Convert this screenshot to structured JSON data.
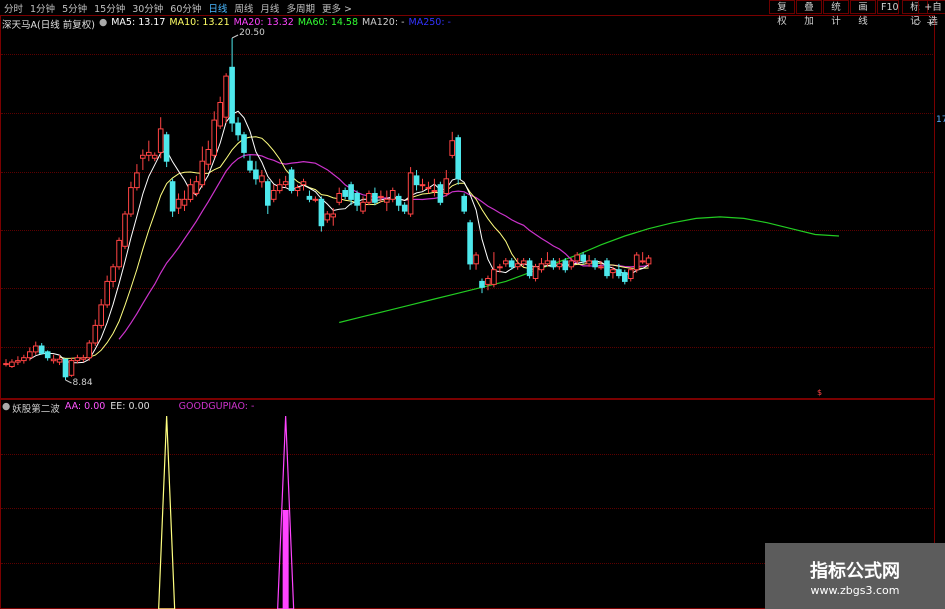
{
  "toolbar": {
    "periods": [
      "分时",
      "1分钟",
      "5分钟",
      "15分钟",
      "30分钟",
      "60分钟",
      "日线",
      "周线",
      "月线",
      "多周期",
      "更多 >"
    ],
    "active_period": "日线",
    "right_buttons": [
      "复权",
      "叠加",
      "统计",
      "画线",
      "F10",
      "标记",
      "+自选"
    ]
  },
  "main_chart": {
    "title": "深天马A",
    "adjust": "(日线 前复权)",
    "ma": [
      {
        "label": "MA5: 13.17",
        "color": "#ffffff"
      },
      {
        "label": "MA10: 13.21",
        "color": "#ffff66"
      },
      {
        "label": "MA20: 13.32",
        "color": "#ff44ff"
      },
      {
        "label": "MA60: 14.58",
        "color": "#33ff33"
      },
      {
        "label": "MA120: -",
        "color": "#cccccc"
      },
      {
        "label": "MA250: -",
        "color": "#3333ff"
      }
    ],
    "high_label": "20.50",
    "low_label": "8.84",
    "right_tag": "17",
    "colors": {
      "up": "#ff4444",
      "down": "#4ee8ec",
      "ma5": "#ffffff",
      "ma10": "#ffff80",
      "ma20": "#cc33cc",
      "ma60": "#22cc22"
    }
  },
  "indicator": {
    "name": "妖股第二波",
    "values": [
      {
        "label": "AA: 0.00",
        "color": "#ff55ff"
      },
      {
        "label": "EE: 0.00",
        "color": "#dddddd"
      },
      {
        "label": "GOODGUPIAO: -",
        "color": "#cc33cc"
      }
    ]
  },
  "watermark": {
    "title": "指标公式网",
    "url": "www.zbgs3.com"
  },
  "chart_data": {
    "type": "candlestick",
    "series_names": [
      "MA5",
      "MA10",
      "MA20",
      "MA60"
    ],
    "price_high": 20.5,
    "price_low": 8.84,
    "candles": [
      {
        "o": 9.4,
        "c": 9.4,
        "h": 9.55,
        "l": 9.3
      },
      {
        "o": 9.3,
        "c": 9.45,
        "h": 9.55,
        "l": 9.25
      },
      {
        "o": 9.45,
        "c": 9.5,
        "h": 9.65,
        "l": 9.35
      },
      {
        "o": 9.5,
        "c": 9.6,
        "h": 9.7,
        "l": 9.4
      },
      {
        "o": 9.6,
        "c": 9.8,
        "h": 9.95,
        "l": 9.5
      },
      {
        "o": 9.8,
        "c": 10.0,
        "h": 10.15,
        "l": 9.7
      },
      {
        "o": 10.0,
        "c": 9.75,
        "h": 10.1,
        "l": 9.7
      },
      {
        "o": 9.8,
        "c": 9.6,
        "h": 9.85,
        "l": 9.5
      },
      {
        "o": 9.5,
        "c": 9.55,
        "h": 9.7,
        "l": 9.4
      },
      {
        "o": 9.45,
        "c": 9.55,
        "h": 9.7,
        "l": 9.35
      },
      {
        "o": 9.55,
        "c": 8.95,
        "h": 9.55,
        "l": 8.84
      },
      {
        "o": 9.0,
        "c": 9.5,
        "h": 9.6,
        "l": 8.95
      },
      {
        "o": 9.5,
        "c": 9.6,
        "h": 9.7,
        "l": 9.4
      },
      {
        "o": 9.55,
        "c": 9.6,
        "h": 9.7,
        "l": 9.45
      },
      {
        "o": 9.6,
        "c": 10.1,
        "h": 10.2,
        "l": 9.5
      },
      {
        "o": 10.1,
        "c": 10.7,
        "h": 10.9,
        "l": 10.0
      },
      {
        "o": 10.7,
        "c": 11.4,
        "h": 11.6,
        "l": 10.6
      },
      {
        "o": 11.4,
        "c": 12.2,
        "h": 12.4,
        "l": 11.3
      },
      {
        "o": 12.2,
        "c": 12.7,
        "h": 12.8,
        "l": 12.0
      },
      {
        "o": 12.7,
        "c": 13.6,
        "h": 13.7,
        "l": 12.6
      },
      {
        "o": 13.4,
        "c": 14.5,
        "h": 14.6,
        "l": 13.3
      },
      {
        "o": 14.5,
        "c": 15.4,
        "h": 15.6,
        "l": 14.4
      },
      {
        "o": 15.4,
        "c": 15.9,
        "h": 16.2,
        "l": 15.3
      },
      {
        "o": 16.4,
        "c": 16.5,
        "h": 16.7,
        "l": 16.0
      },
      {
        "o": 16.5,
        "c": 16.6,
        "h": 17.0,
        "l": 16.3
      },
      {
        "o": 16.4,
        "c": 16.5,
        "h": 16.6,
        "l": 16.3
      },
      {
        "o": 16.6,
        "c": 17.4,
        "h": 17.8,
        "l": 16.4
      },
      {
        "o": 17.2,
        "c": 16.3,
        "h": 17.3,
        "l": 16.1
      },
      {
        "o": 15.6,
        "c": 14.6,
        "h": 15.7,
        "l": 14.4
      },
      {
        "o": 14.7,
        "c": 15.0,
        "h": 15.2,
        "l": 14.5
      },
      {
        "o": 14.8,
        "c": 15.0,
        "h": 15.3,
        "l": 14.6
      },
      {
        "o": 15.0,
        "c": 15.5,
        "h": 15.7,
        "l": 14.9
      },
      {
        "o": 15.2,
        "c": 15.6,
        "h": 15.8,
        "l": 15.1
      },
      {
        "o": 15.5,
        "c": 16.3,
        "h": 16.8,
        "l": 15.4
      },
      {
        "o": 16.2,
        "c": 16.7,
        "h": 17.0,
        "l": 16.0
      },
      {
        "o": 16.5,
        "c": 17.7,
        "h": 18.0,
        "l": 16.4
      },
      {
        "o": 17.5,
        "c": 18.3,
        "h": 18.5,
        "l": 17.4
      },
      {
        "o": 17.8,
        "c": 19.2,
        "h": 19.3,
        "l": 17.6
      },
      {
        "o": 19.5,
        "c": 17.6,
        "h": 20.5,
        "l": 17.3
      },
      {
        "o": 17.6,
        "c": 17.2,
        "h": 17.8,
        "l": 17.0
      },
      {
        "o": 17.2,
        "c": 16.6,
        "h": 17.3,
        "l": 16.4
      },
      {
        "o": 16.3,
        "c": 16.0,
        "h": 16.5,
        "l": 15.9
      },
      {
        "o": 16.0,
        "c": 15.7,
        "h": 16.3,
        "l": 15.5
      },
      {
        "o": 15.6,
        "c": 15.8,
        "h": 16.0,
        "l": 15.4
      },
      {
        "o": 15.6,
        "c": 14.8,
        "h": 15.7,
        "l": 14.5
      },
      {
        "o": 15.0,
        "c": 15.3,
        "h": 15.5,
        "l": 14.9
      },
      {
        "o": 15.3,
        "c": 15.5,
        "h": 15.7,
        "l": 15.2
      },
      {
        "o": 15.5,
        "c": 15.6,
        "h": 15.8,
        "l": 15.4
      },
      {
        "o": 16.0,
        "c": 15.3,
        "h": 16.1,
        "l": 15.2
      },
      {
        "o": 15.3,
        "c": 15.4,
        "h": 15.5,
        "l": 15.1
      },
      {
        "o": 15.5,
        "c": 15.6,
        "h": 15.7,
        "l": 15.3
      },
      {
        "o": 15.1,
        "c": 15.0,
        "h": 15.3,
        "l": 14.9
      },
      {
        "o": 15.0,
        "c": 15.0,
        "h": 15.1,
        "l": 14.9
      },
      {
        "o": 15.0,
        "c": 14.1,
        "h": 15.1,
        "l": 13.9
      },
      {
        "o": 14.3,
        "c": 14.5,
        "h": 14.6,
        "l": 14.2
      },
      {
        "o": 14.4,
        "c": 14.5,
        "h": 14.7,
        "l": 14.1
      },
      {
        "o": 14.9,
        "c": 15.2,
        "h": 15.4,
        "l": 14.8
      },
      {
        "o": 15.3,
        "c": 15.1,
        "h": 15.4,
        "l": 15.0
      },
      {
        "o": 15.5,
        "c": 15.0,
        "h": 15.6,
        "l": 14.8
      },
      {
        "o": 15.2,
        "c": 14.8,
        "h": 15.3,
        "l": 14.6
      },
      {
        "o": 14.6,
        "c": 14.9,
        "h": 15.1,
        "l": 14.5
      },
      {
        "o": 14.9,
        "c": 15.2,
        "h": 15.3,
        "l": 14.8
      },
      {
        "o": 15.2,
        "c": 14.9,
        "h": 15.4,
        "l": 14.8
      },
      {
        "o": 15.1,
        "c": 15.1,
        "h": 15.3,
        "l": 14.9
      },
      {
        "o": 14.9,
        "c": 15.0,
        "h": 15.3,
        "l": 14.6
      },
      {
        "o": 15.0,
        "c": 15.3,
        "h": 15.4,
        "l": 14.9
      },
      {
        "o": 15.1,
        "c": 14.8,
        "h": 15.2,
        "l": 14.6
      },
      {
        "o": 14.8,
        "c": 14.6,
        "h": 14.9,
        "l": 14.5
      },
      {
        "o": 14.5,
        "c": 15.9,
        "h": 16.1,
        "l": 14.4
      },
      {
        "o": 15.8,
        "c": 15.5,
        "h": 16.0,
        "l": 15.3
      },
      {
        "o": 15.5,
        "c": 15.5,
        "h": 15.7,
        "l": 15.3
      },
      {
        "o": 15.4,
        "c": 15.4,
        "h": 15.6,
        "l": 15.2
      },
      {
        "o": 15.3,
        "c": 15.3,
        "h": 15.7,
        "l": 15.1
      },
      {
        "o": 15.5,
        "c": 14.9,
        "h": 15.6,
        "l": 14.8
      },
      {
        "o": 15.2,
        "c": 15.7,
        "h": 16.0,
        "l": 15.1
      },
      {
        "o": 16.5,
        "c": 17.0,
        "h": 17.3,
        "l": 16.4
      },
      {
        "o": 17.1,
        "c": 15.7,
        "h": 17.2,
        "l": 15.5
      },
      {
        "o": 15.1,
        "c": 14.6,
        "h": 15.2,
        "l": 14.5
      },
      {
        "o": 14.2,
        "c": 12.8,
        "h": 14.3,
        "l": 12.6
      },
      {
        "o": 12.8,
        "c": 13.1,
        "h": 13.2,
        "l": 12.6
      },
      {
        "o": 12.2,
        "c": 12.0,
        "h": 12.3,
        "l": 11.8
      },
      {
        "o": 12.1,
        "c": 12.3,
        "h": 12.4,
        "l": 11.9
      },
      {
        "o": 12.1,
        "c": 12.6,
        "h": 13.2,
        "l": 12.0
      },
      {
        "o": 12.7,
        "c": 12.7,
        "h": 12.8,
        "l": 12.5
      },
      {
        "o": 12.8,
        "c": 12.9,
        "h": 13.0,
        "l": 12.7
      },
      {
        "o": 12.9,
        "c": 12.7,
        "h": 13.0,
        "l": 12.6
      },
      {
        "o": 12.7,
        "c": 12.8,
        "h": 13.0,
        "l": 12.6
      },
      {
        "o": 12.8,
        "c": 12.9,
        "h": 13.0,
        "l": 12.7
      },
      {
        "o": 12.9,
        "c": 12.4,
        "h": 13.0,
        "l": 12.3
      },
      {
        "o": 12.3,
        "c": 12.7,
        "h": 12.8,
        "l": 12.2
      },
      {
        "o": 12.6,
        "c": 12.8,
        "h": 13.0,
        "l": 12.5
      },
      {
        "o": 12.8,
        "c": 12.9,
        "h": 13.2,
        "l": 12.7
      },
      {
        "o": 12.9,
        "c": 12.7,
        "h": 13.0,
        "l": 12.6
      },
      {
        "o": 12.7,
        "c": 12.8,
        "h": 13.0,
        "l": 12.6
      },
      {
        "o": 12.9,
        "c": 12.6,
        "h": 13.0,
        "l": 12.5
      },
      {
        "o": 12.7,
        "c": 12.9,
        "h": 13.0,
        "l": 12.6
      },
      {
        "o": 12.9,
        "c": 13.1,
        "h": 13.2,
        "l": 12.8
      },
      {
        "o": 13.1,
        "c": 12.9,
        "h": 13.2,
        "l": 12.8
      },
      {
        "o": 12.8,
        "c": 12.9,
        "h": 13.1,
        "l": 12.7
      },
      {
        "o": 12.9,
        "c": 12.7,
        "h": 13.0,
        "l": 12.6
      },
      {
        "o": 12.7,
        "c": 12.7,
        "h": 12.9,
        "l": 12.6
      },
      {
        "o": 12.9,
        "c": 12.4,
        "h": 13.0,
        "l": 12.3
      },
      {
        "o": 12.5,
        "c": 12.6,
        "h": 12.7,
        "l": 12.3
      },
      {
        "o": 12.6,
        "c": 12.4,
        "h": 12.8,
        "l": 12.3
      },
      {
        "o": 12.5,
        "c": 12.2,
        "h": 12.6,
        "l": 12.1
      },
      {
        "o": 12.3,
        "c": 12.6,
        "h": 12.7,
        "l": 12.2
      },
      {
        "o": 12.6,
        "c": 13.1,
        "h": 13.2,
        "l": 12.5
      },
      {
        "o": 12.9,
        "c": 12.9,
        "h": 13.2,
        "l": 12.8
      },
      {
        "o": 12.8,
        "c": 13.0,
        "h": 13.1,
        "l": 12.7
      }
    ],
    "ma60": [
      [
        56,
        10.8
      ],
      [
        60,
        11.0
      ],
      [
        64,
        11.2
      ],
      [
        68,
        11.4
      ],
      [
        72,
        11.6
      ],
      [
        76,
        11.8
      ],
      [
        80,
        12.0
      ],
      [
        84,
        12.2
      ],
      [
        88,
        12.5
      ],
      [
        92,
        12.8
      ],
      [
        96,
        13.1
      ],
      [
        100,
        13.45
      ],
      [
        104,
        13.75
      ],
      [
        108,
        14.0
      ],
      [
        112,
        14.2
      ],
      [
        116,
        14.35
      ],
      [
        120,
        14.4
      ],
      [
        124,
        14.35
      ],
      [
        128,
        14.2
      ],
      [
        132,
        14.0
      ],
      [
        136,
        13.8
      ],
      [
        140,
        13.75
      ]
    ],
    "indicator_spikes": [
      {
        "index": 27,
        "value": 1.0,
        "color": "#ffff80"
      },
      {
        "index": 47,
        "value": 1.0,
        "color": "#ff44ff"
      }
    ]
  }
}
